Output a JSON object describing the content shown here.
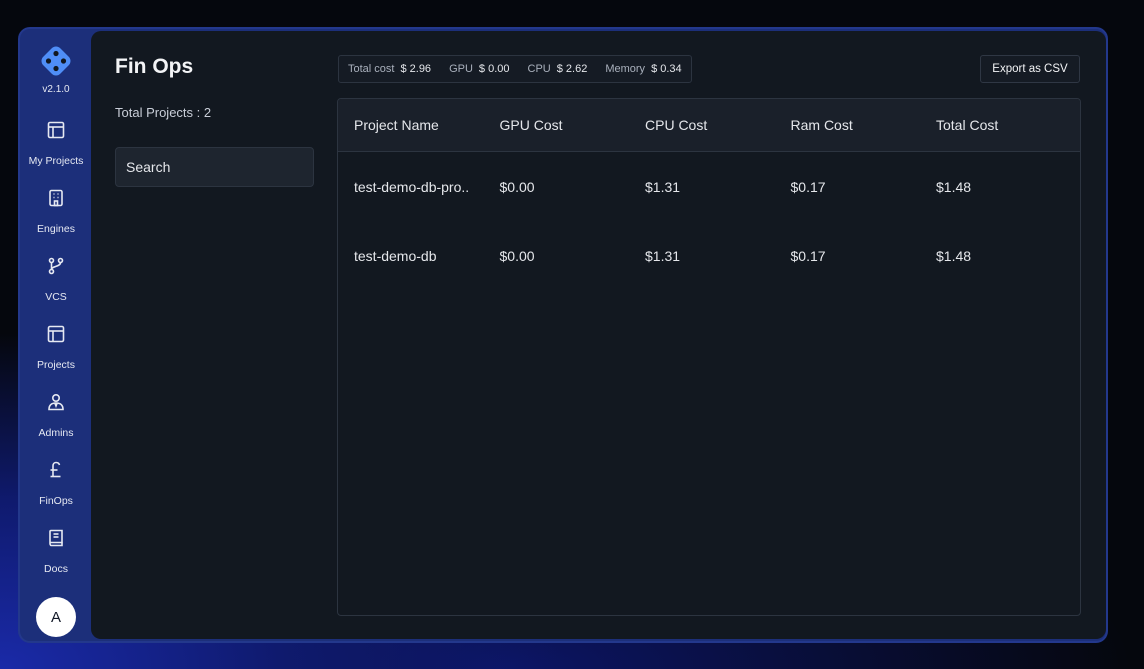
{
  "app": {
    "version": "v2.1.0",
    "avatar_initial": "A"
  },
  "colors": {
    "accent": "#4f8ef7",
    "panel": "#121820",
    "frame": "#1c2f7a"
  },
  "sidebar": {
    "items": [
      {
        "label": "My Projects",
        "icon": "layout-icon"
      },
      {
        "label": "Engines",
        "icon": "building-icon"
      },
      {
        "label": "VCS",
        "icon": "git-branch-icon"
      },
      {
        "label": "Projects",
        "icon": "layout-icon"
      },
      {
        "label": "Admins",
        "icon": "user-tie-icon"
      },
      {
        "label": "FinOps",
        "icon": "pound-icon"
      },
      {
        "label": "Docs",
        "icon": "book-icon"
      }
    ]
  },
  "page": {
    "title": "Fin Ops",
    "total_projects": "Total Projects : 2",
    "search_placeholder": "Search",
    "export_label": "Export as CSV"
  },
  "summary": [
    {
      "key": "Total cost",
      "value": "$ 2.96"
    },
    {
      "key": "GPU",
      "value": "$ 0.00"
    },
    {
      "key": "CPU",
      "value": "$ 2.62"
    },
    {
      "key": "Memory",
      "value": "$ 0.34"
    }
  ],
  "table": {
    "headers": [
      "Project Name",
      "GPU Cost",
      "CPU Cost",
      "Ram Cost",
      "Total Cost"
    ],
    "rows": [
      [
        "test-demo-db-pro..",
        "$0.00",
        "$1.31",
        "$0.17",
        "$1.48"
      ],
      [
        "test-demo-db",
        "$0.00",
        "$1.31",
        "$0.17",
        "$1.48"
      ]
    ]
  }
}
